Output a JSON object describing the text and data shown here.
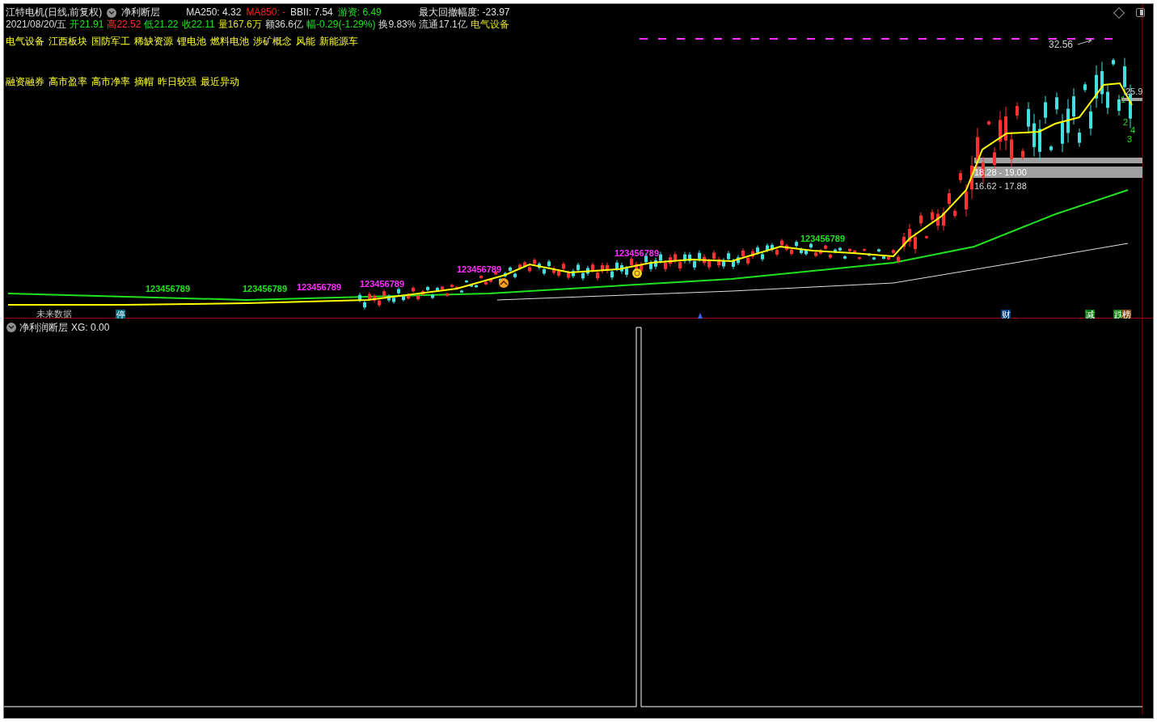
{
  "header": {
    "stock": "江特电机(日线,前复权)",
    "indicator": "净利断层",
    "stats": [
      {
        "text": "MA250: 4.32",
        "color": "#e0e0e0"
      },
      {
        "text": "MA850: -",
        "color": "#ff2020"
      },
      {
        "text": "BBII: 7.54",
        "color": "#e0e0e0"
      },
      {
        "text": "游资: 6.49",
        "color": "#20e020"
      }
    ],
    "drawdown": "最大回撤幅度: -23.97"
  },
  "quote": [
    {
      "text": "2021/08/20/五",
      "color": "#d8d8d8"
    },
    {
      "text": "开21.91",
      "color": "#20e020"
    },
    {
      "text": "高22.52",
      "color": "#ff3030"
    },
    {
      "text": "低21.22",
      "color": "#20e020"
    },
    {
      "text": "收22.11",
      "color": "#20e020"
    },
    {
      "text": "量167.6万",
      "color": "#e0e020"
    },
    {
      "text": "额36.6亿",
      "color": "#d8d8d8"
    },
    {
      "text": "幅-0.29(-1.29%)",
      "color": "#20e020"
    },
    {
      "text": "换9.83%",
      "color": "#d8d8d8"
    },
    {
      "text": "流通17.1亿",
      "color": "#d8d8d8"
    },
    {
      "text": "电气设备",
      "color": "#e0e020"
    }
  ],
  "concepts": [
    "电气设备",
    "江西板块",
    "国防军工",
    "稀缺资源",
    "锂电池",
    "燃料电池",
    "涉矿概念",
    "风能",
    "新能源车"
  ],
  "tags": [
    "融资融券",
    "高市盈率",
    "高市净率",
    "摘帽",
    "昨日较强",
    "最近异动"
  ],
  "chart_labels": {
    "high": "32.56",
    "last": "25.9",
    "zones": [
      "18.28 - 19.00",
      "16.62 - 17.88"
    ],
    "counts": [
      "1",
      "2",
      "3",
      "4"
    ],
    "future": "未来数据"
  },
  "sequences": [
    {
      "text": "123456789",
      "color": "#20e020"
    },
    {
      "text": "123456789",
      "color": "#20e020"
    },
    {
      "text": "123456789",
      "color": "#ff30ff"
    },
    {
      "text": "123456789",
      "color": "#ff30ff"
    },
    {
      "text": "123456789",
      "color": "#ff30ff"
    },
    {
      "text": "123456789",
      "color": "#ff30ff"
    },
    {
      "text": "123456789",
      "color": "#20e020"
    }
  ],
  "badges": [
    {
      "text": "停",
      "color": "#006a80"
    },
    {
      "text": "财",
      "color": "#003c80"
    },
    {
      "text": "减",
      "color": "#0a7a0a"
    },
    {
      "text": "跌",
      "color": "#0a7a0a"
    },
    {
      "text": "榜",
      "color": "#8a4a10"
    }
  ],
  "lower_panel": {
    "title": "净利润断层",
    "reading": "XG: 0.00"
  }
}
